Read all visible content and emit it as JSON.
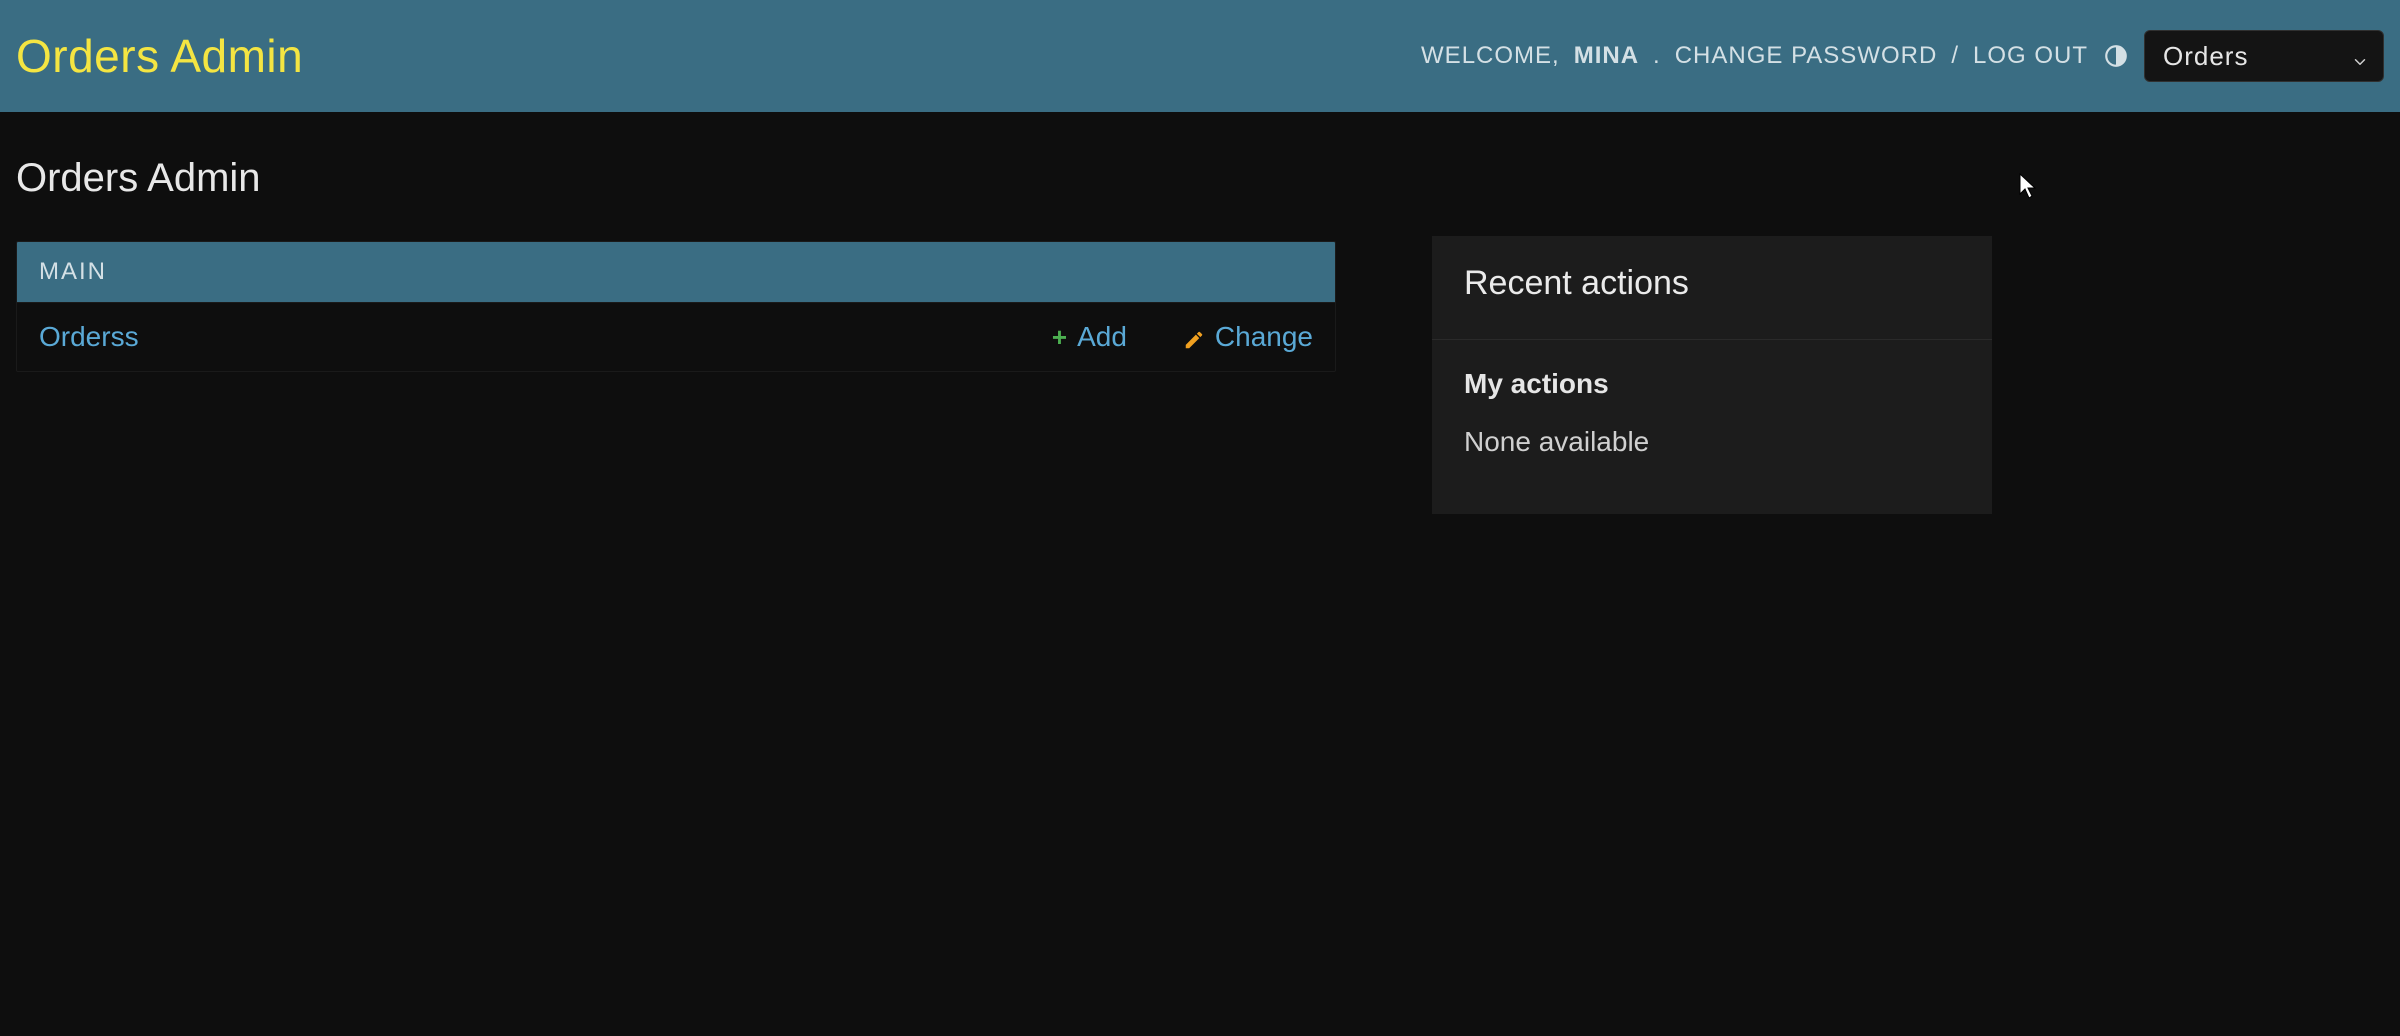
{
  "header": {
    "site_title": "Orders Admin",
    "welcome_prefix": "WELCOME,",
    "username": "MINA",
    "welcome_suffix": ".",
    "change_password_label": "CHANGE PASSWORD",
    "separator": "/",
    "logout_label": "LOG OUT",
    "site_select_value": "Orders"
  },
  "page": {
    "title": "Orders Admin"
  },
  "module": {
    "app_label": "MAIN",
    "model_name": "Orderss",
    "add_label": "Add",
    "change_label": "Change"
  },
  "sidebar": {
    "recent_actions_title": "Recent actions",
    "my_actions_label": "My actions",
    "none_available": "None available"
  }
}
